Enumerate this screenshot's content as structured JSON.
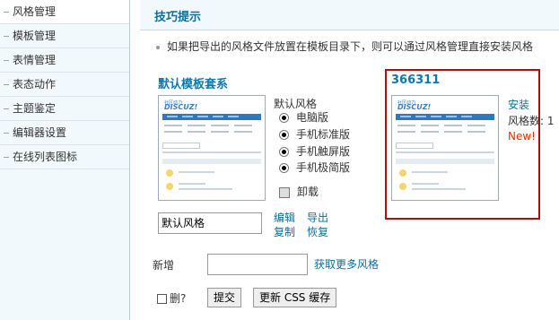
{
  "sidebar": {
    "items": [
      {
        "label": "风格管理",
        "active": true
      },
      {
        "label": "模板管理"
      },
      {
        "label": "表情管理"
      },
      {
        "label": "表态动作"
      },
      {
        "label": "主题鉴定"
      },
      {
        "label": "编辑器设置"
      },
      {
        "label": "在线列表图标"
      }
    ]
  },
  "tips": {
    "title": "技巧提示",
    "item": "如果把导出的风格文件放置在模板目录下，则可以通过风格管理直接安装风格"
  },
  "default_style": {
    "name": "默认模板套系",
    "thumbnail_logo_top": "社区动力",
    "thumbnail_logo": "DISCUZ!",
    "radio_title": "默认风格",
    "radios": [
      {
        "label": "电脑版",
        "checked": true
      },
      {
        "label": "手机标准版",
        "checked": true
      },
      {
        "label": "手机触屏版",
        "checked": true
      },
      {
        "label": "手机极简版",
        "checked": true
      }
    ],
    "uninstall_label": "卸载",
    "uninstall_checked": false,
    "name_input_value": "默认风格",
    "actions": {
      "edit": "编辑",
      "export": "导出",
      "copy": "复制",
      "restore": "恢复"
    }
  },
  "new_style": {
    "name": "366311",
    "install_label": "安装",
    "count_label": "风格数: 1",
    "new_badge": "New!"
  },
  "add_row": {
    "label": "新增",
    "input_value": "",
    "more_link": "获取更多风格"
  },
  "footer": {
    "delete_label": "删?",
    "submit_label": "提交",
    "update_css_label": "更新 CSS 缓存"
  },
  "colors": {
    "accent": "#0e6d9b",
    "highlight_border": "#b00e12",
    "new_badge": "#ff2a00",
    "sidebar_bg": "#f2f9fd"
  }
}
